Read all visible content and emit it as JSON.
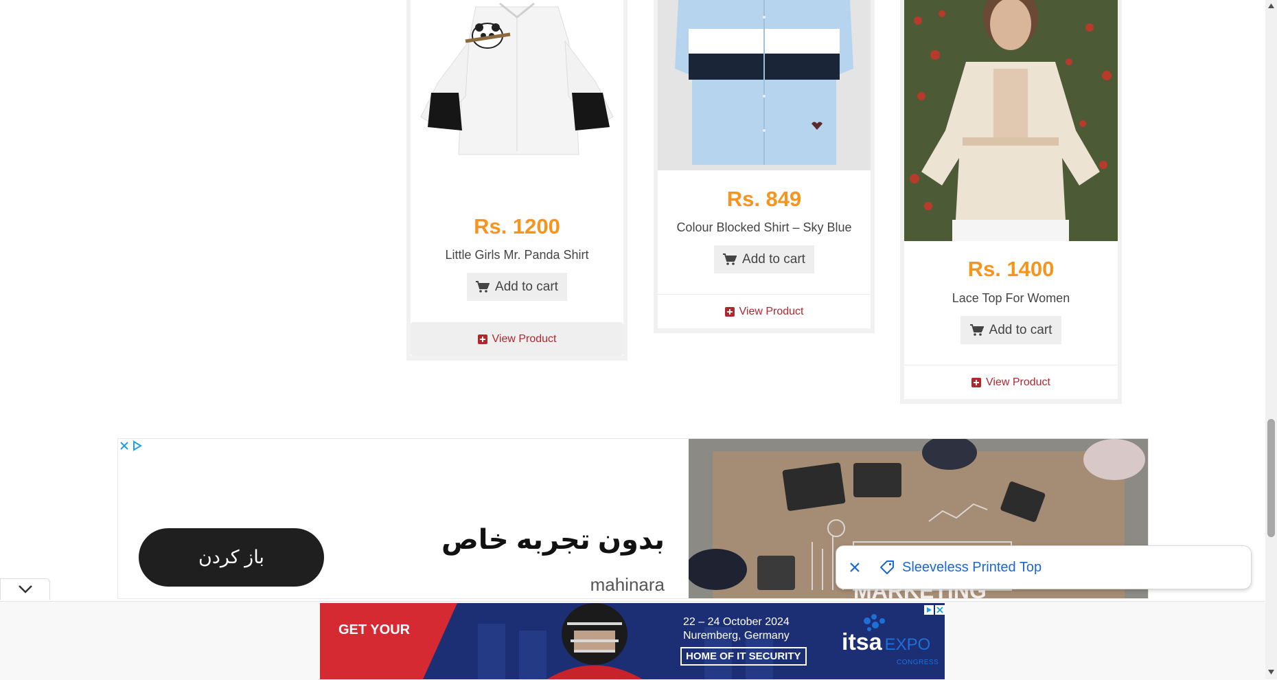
{
  "products": [
    {
      "price": "Rs. 1200",
      "name": "Little Girls Mr. Panda Shirt",
      "cart": "Add to cart",
      "view": "View Product"
    },
    {
      "price": "Rs. 849",
      "name": "Colour Blocked Shirt – Sky Blue",
      "cart": "Add to cart",
      "view": "View Product"
    },
    {
      "price": "Rs. 1400",
      "name": "Lace Top For Women",
      "cart": "Add to cart",
      "view": "View Product"
    }
  ],
  "ad": {
    "button": "باز کردن",
    "headline": "بدون تجربه خاص",
    "brand": "mahinara",
    "image_caption": "MARKETING"
  },
  "chip": {
    "label": "Sleeveless Printed Top"
  },
  "banner": {
    "get": "GET YOUR",
    "dates": "22 – 24 October 2024",
    "place": "Nuremberg, Germany",
    "home": "HOME OF IT SECURITY",
    "logo_it": "it",
    "logo_sa": "sa",
    "logo_expo": "EXPO",
    "logo_congress": "CONGRESS"
  }
}
